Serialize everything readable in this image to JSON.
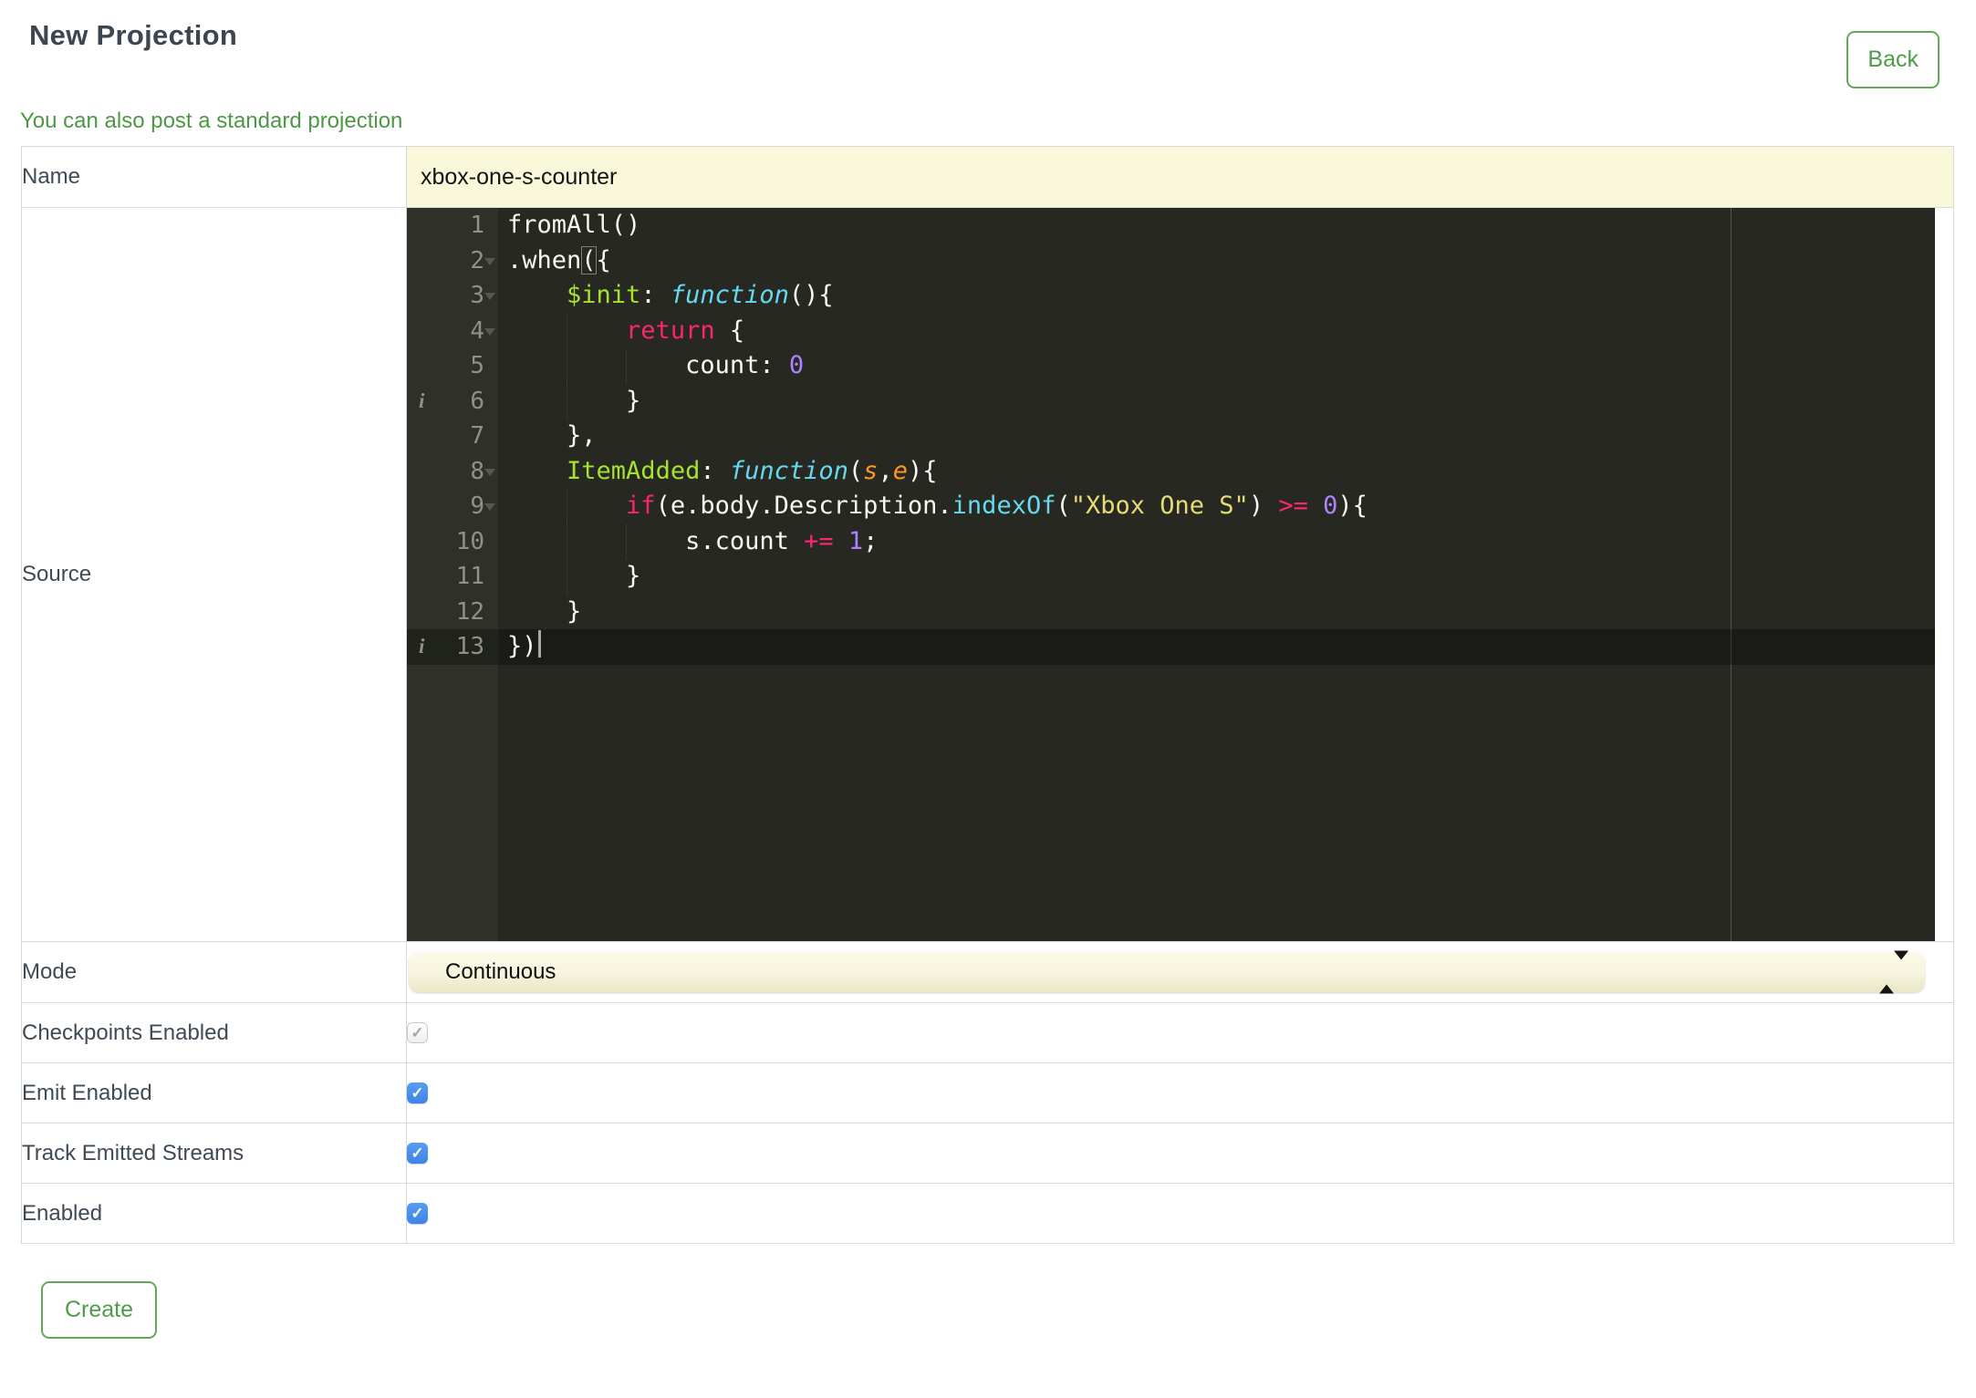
{
  "header": {
    "title": "New Projection",
    "back_label": "Back"
  },
  "link": {
    "text": "You can also post a standard projection"
  },
  "form": {
    "rows": [
      {
        "label": "Name",
        "type": "text",
        "value": "xbox-one-s-counter"
      },
      {
        "label": "Source",
        "type": "code"
      },
      {
        "label": "Mode",
        "type": "select",
        "value": "Continuous"
      },
      {
        "label": "Checkpoints Enabled",
        "type": "checkbox",
        "checked": true,
        "disabled": true
      },
      {
        "label": "Emit Enabled",
        "type": "checkbox",
        "checked": true,
        "disabled": false
      },
      {
        "label": "Track Emitted Streams",
        "type": "checkbox",
        "checked": true,
        "disabled": false
      },
      {
        "label": "Enabled",
        "type": "checkbox",
        "checked": true,
        "disabled": false
      }
    ],
    "checkmark_glyph": "✓",
    "create_label": "Create"
  },
  "colors": {
    "accent_green": "#4C9845",
    "button_border_green": "#5FAB54",
    "title_text": "#3C4650",
    "table_border": "#D9D9D9",
    "name_field_bg": "#FAF8DB",
    "select_bg": "#F6F4DC",
    "checkbox_blue": "#4A90E9",
    "editor_bg": "#272822",
    "editor_gutter_bg": "#2F3129",
    "editor_active_line": "#1B1C17",
    "editor_line_number": "#8F908A"
  },
  "editor": {
    "token_colors": {
      "pl": "#F8F8F2",
      "kw": "#F92672",
      "fn": "#66D9EF",
      "sup": "#66D9EF",
      "ent": "#A6E22E",
      "num": "#AE81FF",
      "str": "#E6DB74",
      "par": "#FD971F",
      "bm": "#F8F8F2"
    },
    "lines": [
      {
        "n": 1,
        "seg": [
          [
            "pl",
            "fromAll()"
          ]
        ]
      },
      {
        "n": 2,
        "fold": true,
        "seg": [
          [
            "pl",
            ".when"
          ],
          [
            "bm",
            "("
          ],
          [
            "pl",
            "{"
          ]
        ]
      },
      {
        "n": 3,
        "fold": true,
        "seg": [
          [
            "pl",
            "    "
          ],
          [
            "ent",
            "$init"
          ],
          [
            "pl",
            ": "
          ],
          [
            "fn",
            "function"
          ],
          [
            "pl",
            "(){"
          ]
        ]
      },
      {
        "n": 4,
        "fold": true,
        "seg": [
          [
            "pl",
            "        "
          ],
          [
            "kw",
            "return"
          ],
          [
            "pl",
            " {"
          ]
        ]
      },
      {
        "n": 5,
        "seg": [
          [
            "pl",
            "            count: "
          ],
          [
            "num",
            "0"
          ]
        ]
      },
      {
        "n": 6,
        "info": true,
        "seg": [
          [
            "pl",
            "        }"
          ]
        ]
      },
      {
        "n": 7,
        "seg": [
          [
            "pl",
            "    },"
          ]
        ]
      },
      {
        "n": 8,
        "fold": true,
        "seg": [
          [
            "pl",
            "    "
          ],
          [
            "ent",
            "ItemAdded"
          ],
          [
            "pl",
            ": "
          ],
          [
            "fn",
            "function"
          ],
          [
            "pl",
            "("
          ],
          [
            "par",
            "s"
          ],
          [
            "pl",
            ","
          ],
          [
            "par",
            "e"
          ],
          [
            "pl",
            "){"
          ]
        ]
      },
      {
        "n": 9,
        "fold": true,
        "seg": [
          [
            "pl",
            "        "
          ],
          [
            "kw",
            "if"
          ],
          [
            "pl",
            "(e.body.Description."
          ],
          [
            "sup",
            "indexOf"
          ],
          [
            "pl",
            "("
          ],
          [
            "str",
            "\"Xbox One S\""
          ],
          [
            "pl",
            ") "
          ],
          [
            "kw",
            ">="
          ],
          [
            "pl",
            " "
          ],
          [
            "num",
            "0"
          ],
          [
            "pl",
            "){"
          ]
        ]
      },
      {
        "n": 10,
        "seg": [
          [
            "pl",
            "            s.count "
          ],
          [
            "kw",
            "+="
          ],
          [
            "pl",
            " "
          ],
          [
            "num",
            "1"
          ],
          [
            "pl",
            ";"
          ]
        ]
      },
      {
        "n": 11,
        "seg": [
          [
            "pl",
            "        }"
          ]
        ]
      },
      {
        "n": 12,
        "seg": [
          [
            "pl",
            "    }"
          ]
        ]
      },
      {
        "n": 13,
        "info": true,
        "active": true,
        "cursor": true,
        "seg": [
          [
            "pl",
            "})"
          ]
        ]
      }
    ]
  }
}
